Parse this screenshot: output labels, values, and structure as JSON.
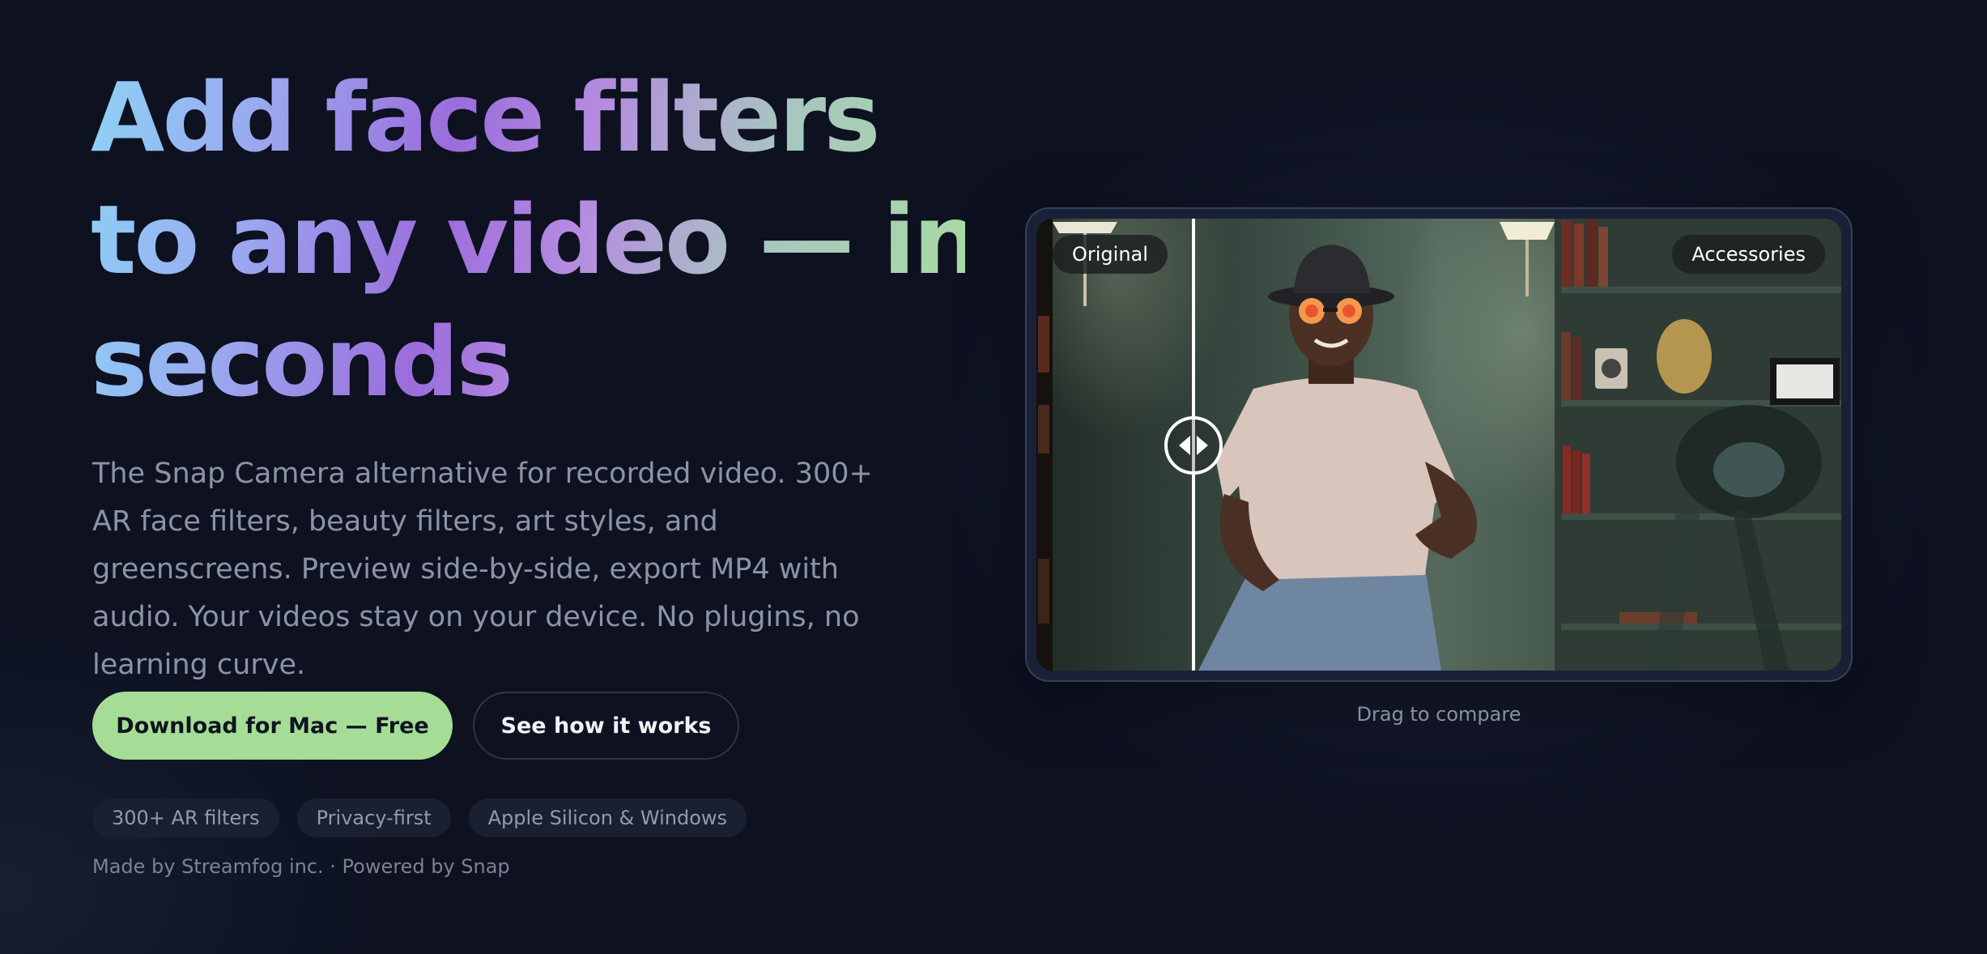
{
  "hero": {
    "title_lines": [
      "Add face filters",
      "to any video — in",
      "seconds"
    ],
    "subtitle": "The Snap Camera alternative for recorded video. 300+ AR face filters, beauty filters, art styles, and greenscreens. Preview side-by-side, export MP4 with audio. Your videos stay on your device. No plugins, no learning curve.",
    "gradient_colors": [
      "#8dd3f6",
      "#9b6ddc",
      "#a9dca0"
    ]
  },
  "actions": {
    "primary_label": "Download for Mac — Free",
    "secondary_label": "See how it works",
    "primary_color": "#a6dd96"
  },
  "badges": [
    "300+ AR filters",
    "Privacy-first",
    "Apple Silicon & Windows"
  ],
  "footer": {
    "credit": "Made by Streamfog inc. · Powered by Snap"
  },
  "preview": {
    "left_label": "Original",
    "right_label": "Accessories",
    "hint": "Drag to compare",
    "handle_icon": "left-right-arrows-icon"
  },
  "colors": {
    "background": "#0d1120",
    "frame_border": "#34405e"
  }
}
